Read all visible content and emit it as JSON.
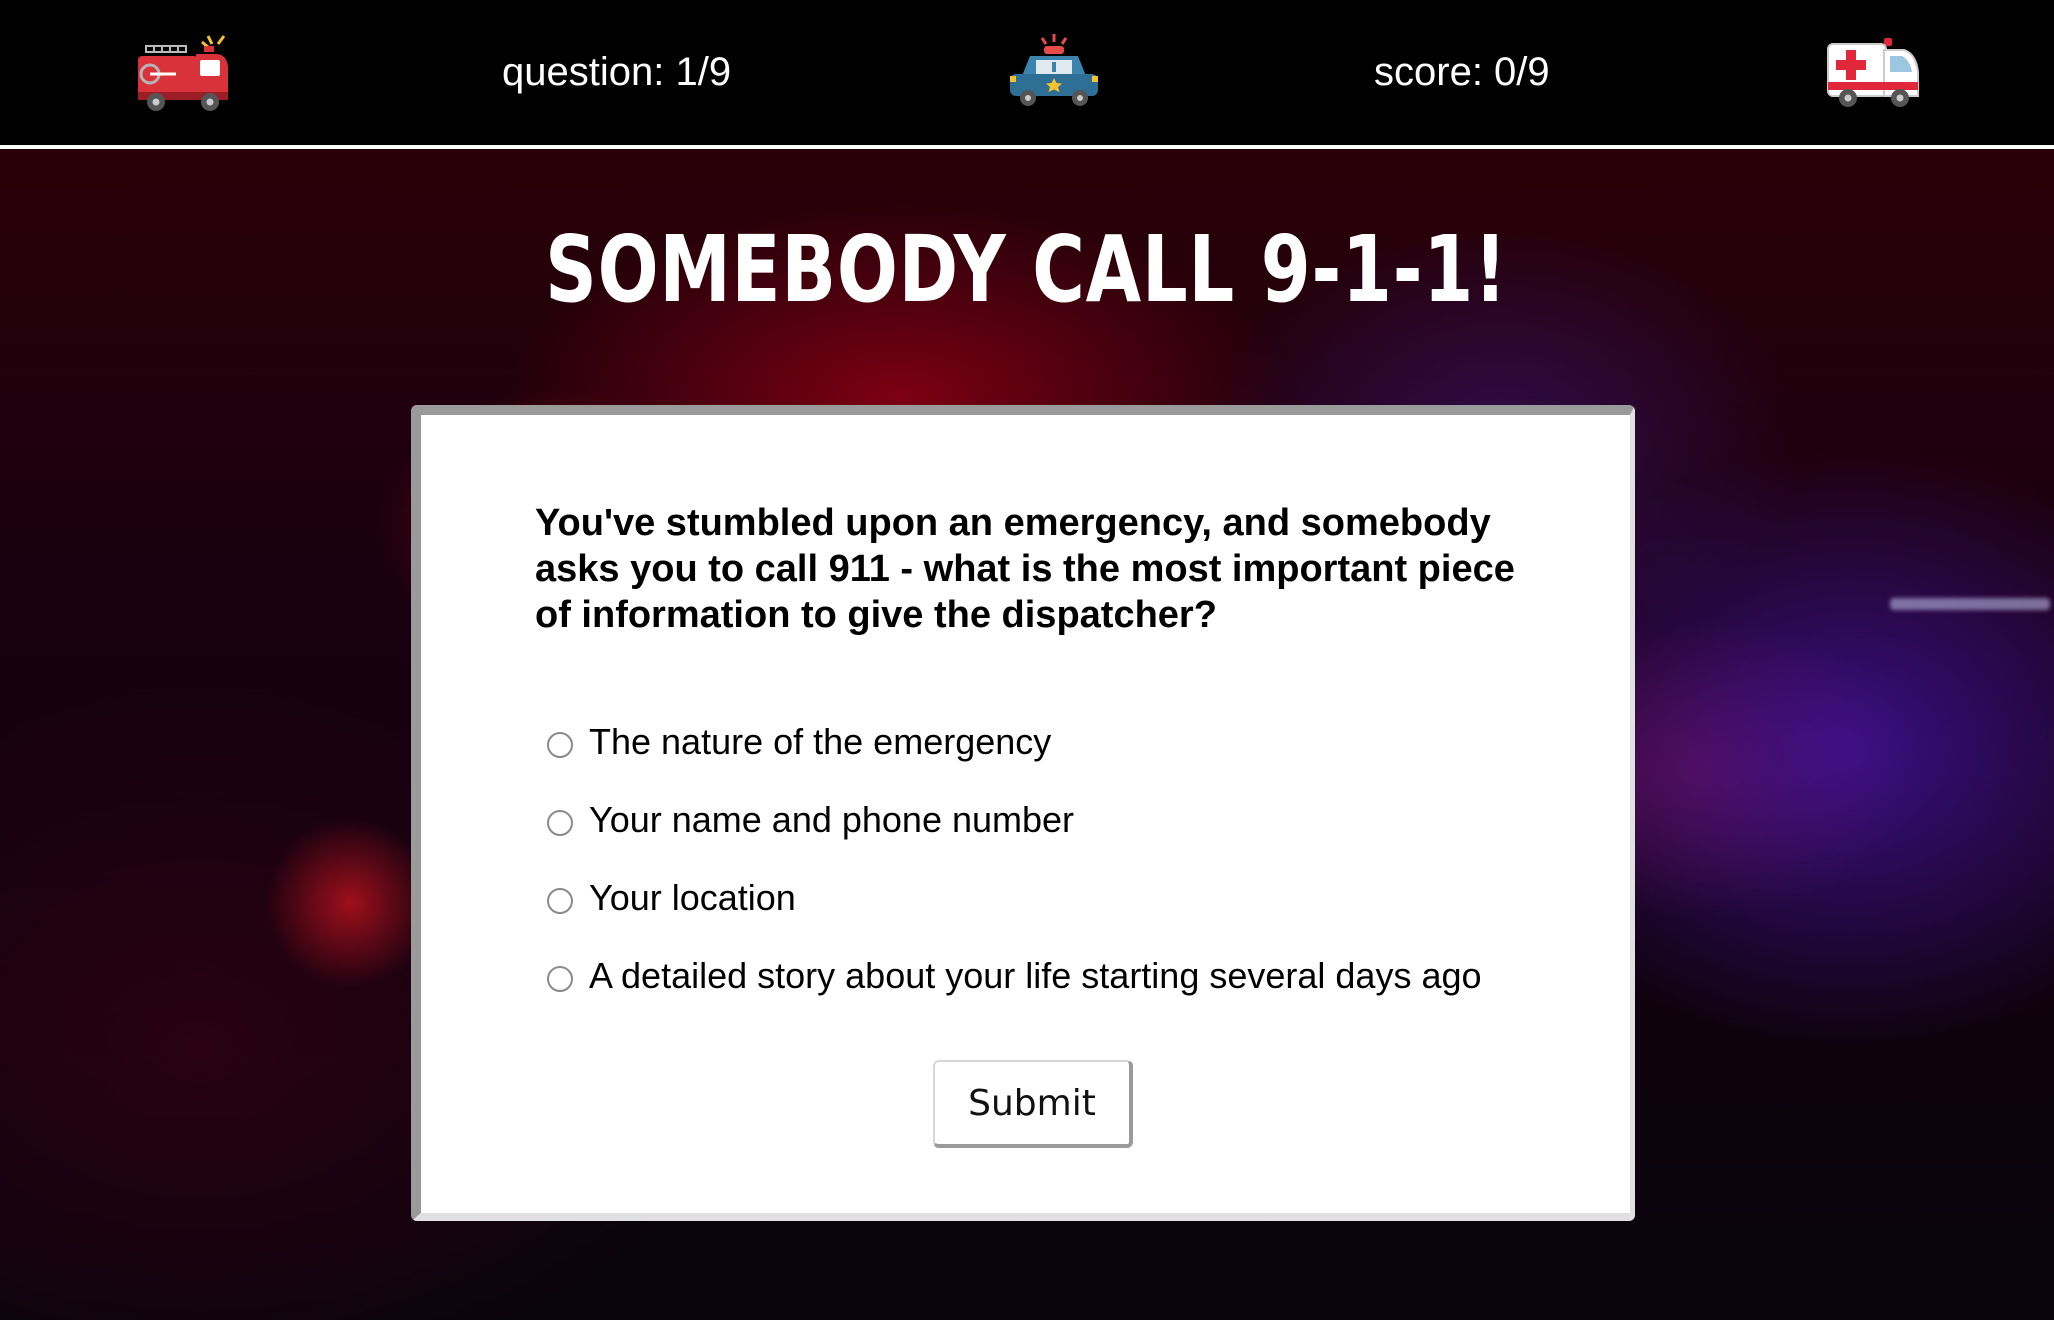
{
  "header": {
    "question_counter": "question: 1/9",
    "score": "score: 0/9",
    "left_icon": "fire-truck-icon",
    "center_icon": "police-car-icon",
    "right_icon": "ambulance-icon"
  },
  "main": {
    "title": "SOMEBODY CALL 9-1-1!",
    "question": "You've stumbled upon an emergency, and somebody asks you to call 911 - what is the most important piece of information to give the dispatcher?",
    "options": [
      "The nature of the emergency",
      "Your name and phone number",
      "Your location",
      "A detailed story about your life starting several days ago"
    ],
    "submit_label": "Submit"
  },
  "colors": {
    "header_bg": "#000000",
    "card_bg": "#ffffff",
    "fire_truck_red": "#d9323b",
    "police_blue": "#2e6f96",
    "ambulance_red": "#e0283a"
  }
}
